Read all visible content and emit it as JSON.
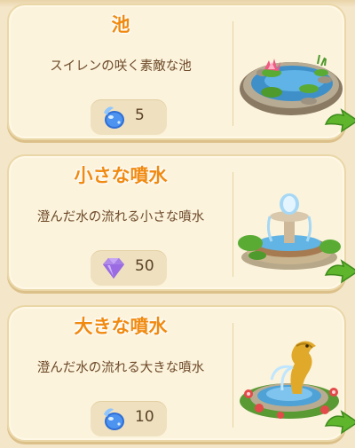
{
  "items": [
    {
      "title": "池",
      "description": "スイレンの咲く素敵な池",
      "cost_value": "5",
      "cost_icon": "water-drop-icon",
      "art": "pond-with-water-lilies"
    },
    {
      "title": "小さな噴水",
      "description": "澄んだ水の流れる小さな噴水",
      "cost_value": "50",
      "cost_icon": "purple-gem-icon",
      "art": "small-fountain"
    },
    {
      "title": "大きな噴水",
      "description": "澄んだ水の流れる大きな噴水",
      "cost_value": "10",
      "cost_icon": "water-drop-icon",
      "art": "large-dolphin-fountain"
    }
  ],
  "colors": {
    "title": "#f08a10",
    "card_bg": "#fbf3dc",
    "accent_green": "#5fb52c"
  }
}
